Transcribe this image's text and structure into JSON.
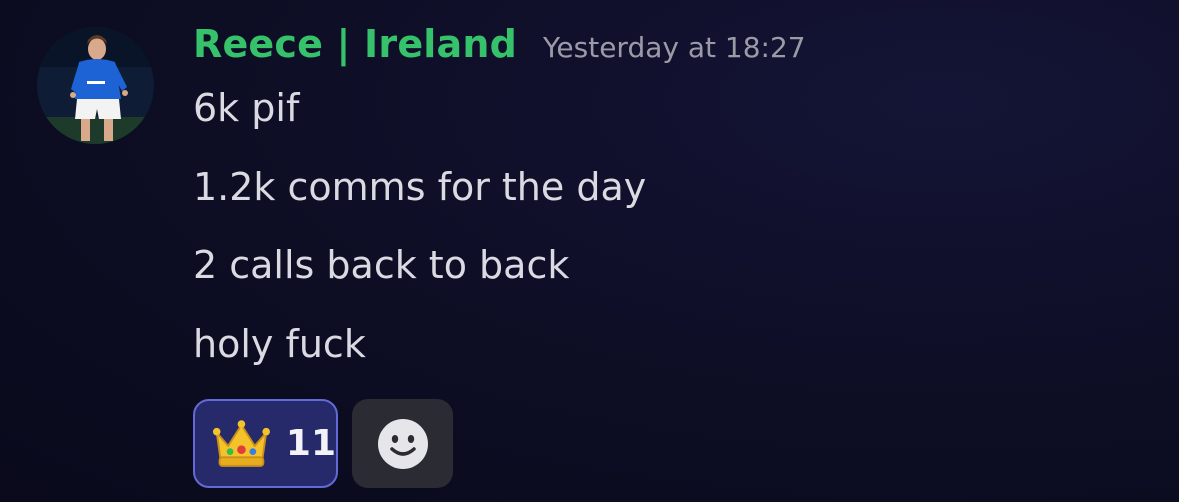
{
  "message": {
    "author": "Reece | Ireland",
    "timestamp": "Yesterday at 18:27",
    "lines": [
      "6k pif",
      "1.2k comms for the day",
      "2 calls back to back",
      "holy fuck"
    ],
    "reactions": [
      {
        "emoji": "crown-icon",
        "count": "11",
        "active": true
      }
    ],
    "colors": {
      "author": "#35c26b",
      "reaction_bg": "#262a6a",
      "reaction_border": "#6469d8",
      "add_reaction_bg": "#2a2b33"
    }
  }
}
